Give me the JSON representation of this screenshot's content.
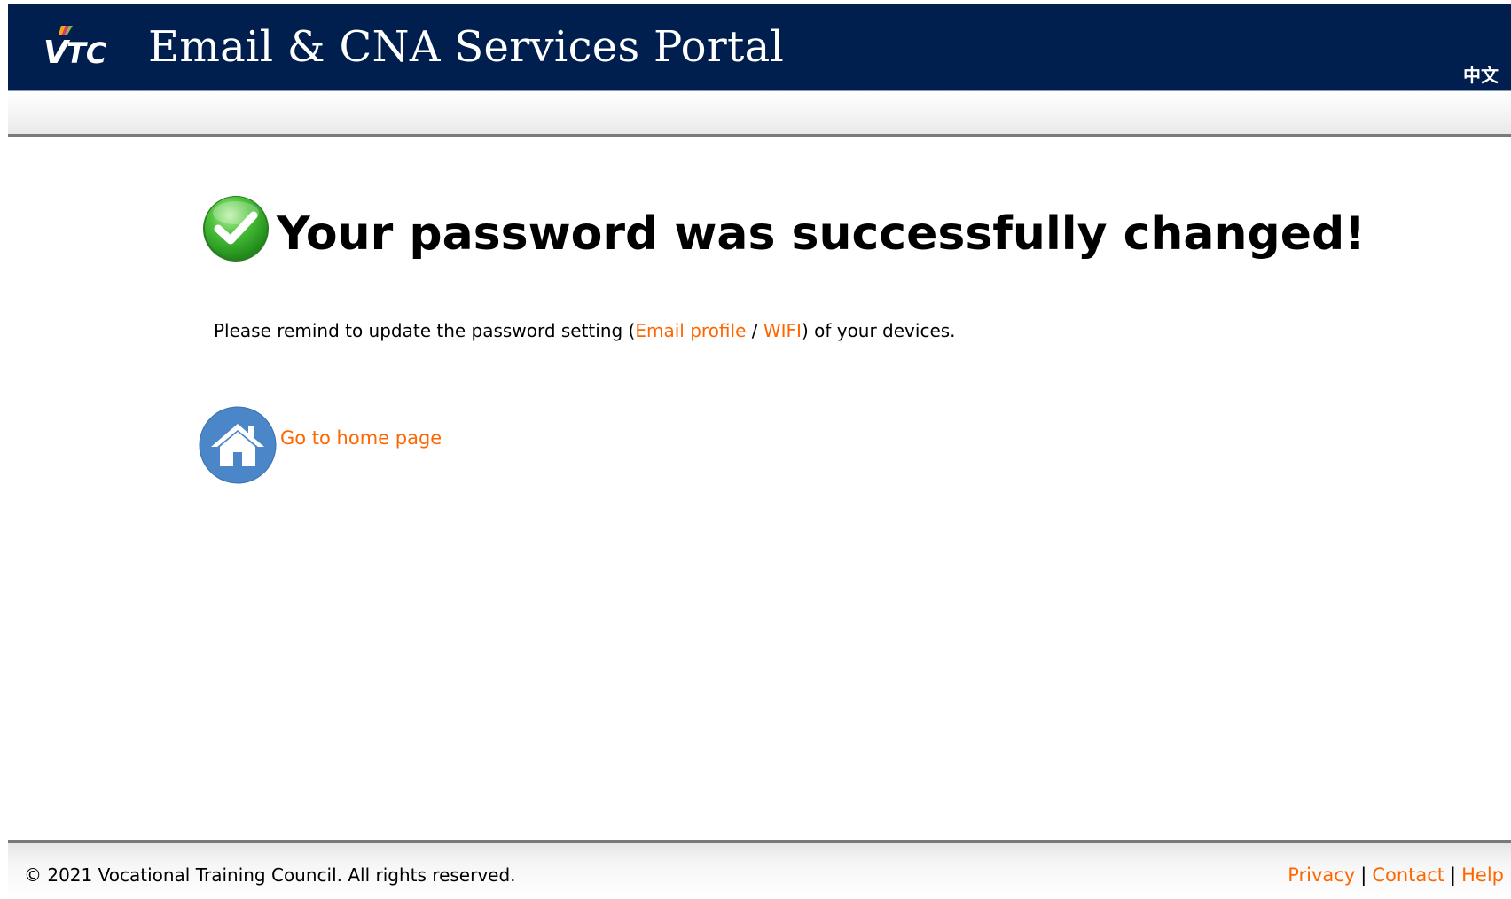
{
  "header": {
    "logo_text": "VTC",
    "title": "Email & CNA Services Portal",
    "language_link": "中文"
  },
  "main": {
    "success_title": "Your password was successfully changed!",
    "reminder": {
      "prefix": "Please remind to update the password setting (",
      "email_profile_link": "Email profile",
      "slash": " / ",
      "wifi_link": "WIFI",
      "suffix": ") of your devices."
    },
    "home_link": "Go to home page"
  },
  "footer": {
    "copyright": "© 2021 Vocational Training Council. All rights reserved.",
    "links": {
      "privacy": "Privacy",
      "contact": "Contact",
      "help": "Help",
      "separator": "|"
    }
  },
  "colors": {
    "header_bg": "#001f4e",
    "link_orange": "#ff6600",
    "success_green": "#3fae2a",
    "home_blue": "#4a86c8"
  },
  "icons": {
    "success": "check-circle-icon",
    "home": "home-icon"
  }
}
